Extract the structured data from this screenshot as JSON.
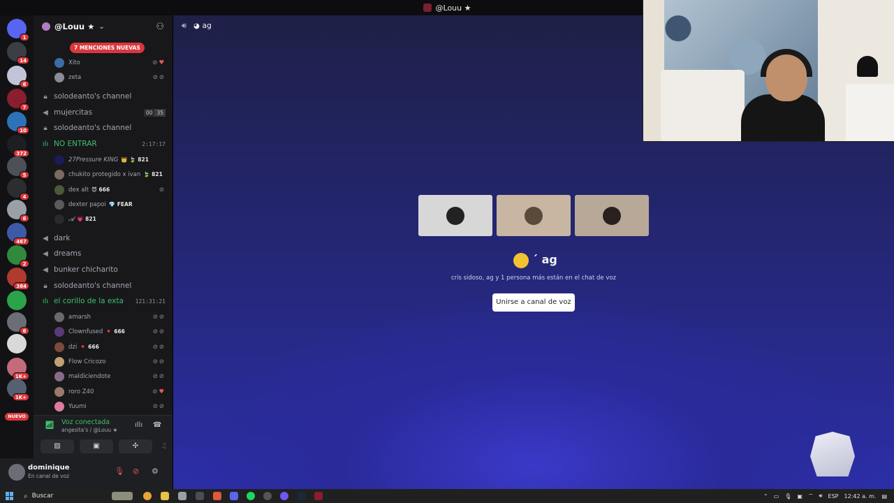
{
  "window": {
    "title": "@Louu ★"
  },
  "rail": {
    "servers": [
      {
        "name": "discord-home",
        "badge": "1",
        "color": "#5865f2"
      },
      {
        "name": "server",
        "badge": "14",
        "color": "#3b3e45"
      },
      {
        "name": "server",
        "badge": "6",
        "color": "#c0c4d6"
      },
      {
        "name": "server",
        "badge": "7",
        "color": "#8a1e2e"
      },
      {
        "name": "server",
        "badge": "10",
        "color": "#2c72b8"
      },
      {
        "name": "server",
        "badge": "372",
        "color": "#1e1f22"
      },
      {
        "name": "server",
        "badge": "5",
        "color": "#4e5058"
      },
      {
        "name": "server",
        "badge": "4",
        "color": "#2b2d31"
      },
      {
        "name": "server",
        "badge": "6",
        "color": "#9aa0a8"
      },
      {
        "name": "server",
        "badge": "467",
        "color": "#3d5aa8"
      },
      {
        "name": "server",
        "badge": "2",
        "color": "#2f8a3b"
      },
      {
        "name": "server",
        "badge": "384",
        "color": "#b03a2e"
      },
      {
        "name": "server",
        "badge": "",
        "color": "#2aa34a"
      },
      {
        "name": "server",
        "badge": "6",
        "color": "#6b6e75"
      },
      {
        "name": "server",
        "badge": "",
        "color": "#d9d9d9"
      },
      {
        "name": "server",
        "badge": "1K+",
        "color": "#c46a7a"
      },
      {
        "name": "server",
        "badge": "1K+",
        "color": "#556070"
      }
    ],
    "nuevo_label": "NUEVO"
  },
  "sidebar": {
    "guild_name": "@Louu ★",
    "mentions_pill": "7 MENCIONES NUEVAS",
    "top_users": [
      {
        "name": "Xito"
      },
      {
        "name": "zeta"
      }
    ],
    "channels": {
      "c1": "solodeanto's channel",
      "c2": "mujercitas",
      "c2_limit_a": "00",
      "c2_limit_b": "35",
      "c3": "solodeanto's channel",
      "c4": "NO ENTRAR",
      "c4_time": "2:17:17",
      "c5": "dark",
      "c6": "dreams",
      "c7": "bunker chicharito",
      "c8": "solodeanto's channel",
      "c9": "el corillo de la exta",
      "c9_time": "121:31:21"
    },
    "no_entrar_users": [
      {
        "name": "27Pressure KING",
        "tag": "👑 🍃 821"
      },
      {
        "name": "chukito protegido x ivan",
        "tag": "🍃 821"
      },
      {
        "name": "dex alt",
        "tag": "😈 666"
      },
      {
        "name": "dexter papoi",
        "tag": "💎 FEAR"
      },
      {
        "name": "𝓐",
        "tag": "💗 821"
      }
    ],
    "corillo_users": [
      {
        "name": "amarsh",
        "tag": ""
      },
      {
        "name": "Clownfused",
        "tag": "🔻 666"
      },
      {
        "name": "dzi",
        "tag": "🔻 666"
      },
      {
        "name": "Flow Cricozo",
        "tag": ""
      },
      {
        "name": "maldiciendote",
        "tag": ""
      },
      {
        "name": "roro Z40",
        "tag": ""
      },
      {
        "name": "Yuumi",
        "tag": ""
      }
    ]
  },
  "voice_panel": {
    "title": "Voz conectada",
    "subtitle": "angesita's / @Louu ★"
  },
  "user_panel": {
    "username": "dominique",
    "status": "En canal de voz"
  },
  "stage": {
    "header_channel": "ag",
    "channel_name": "´ ag",
    "description": "cris sidoso, ag y 1 persona más están en el chat de voz",
    "join_button": "Unirse a canal de voz"
  },
  "taskbar": {
    "search_label": "Buscar",
    "lang": "ESP",
    "time": "12:42 a. m."
  }
}
